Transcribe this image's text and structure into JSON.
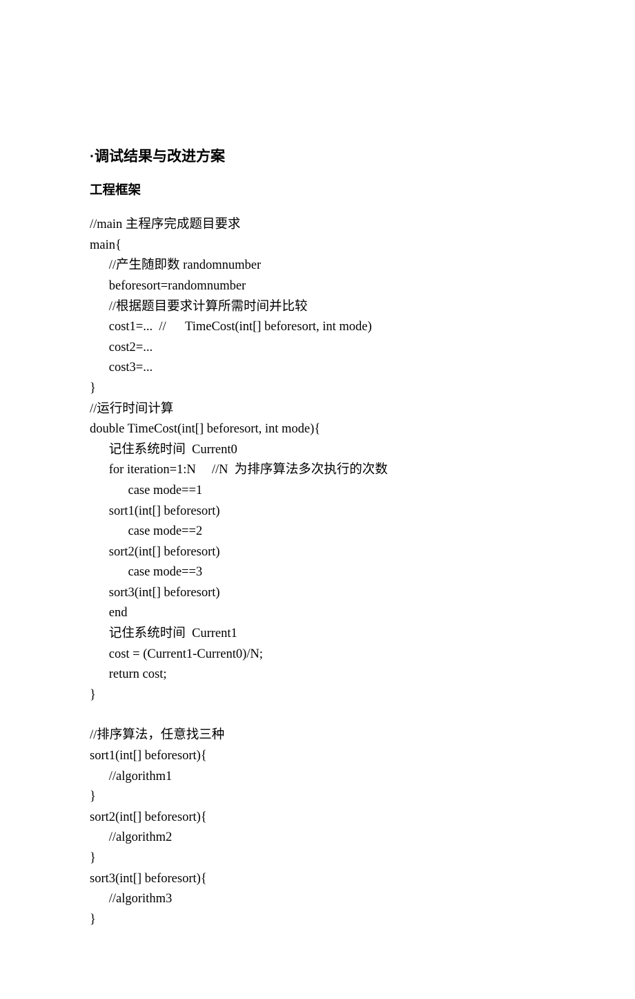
{
  "heading": "·调试结果与改进方案",
  "subheading": "工程框架",
  "lines": {
    "l1": "//main 主程序完成题目要求",
    "l2": "main{",
    "l3": "      //产生随即数 randomnumber",
    "l4": "      beforesort=randomnumber",
    "l5": "      //根据题目要求计算所需时间并比较",
    "l6": "      cost1=...  //      TimeCost(int[] beforesort, int mode)",
    "l7": "      cost2=...",
    "l8": "      cost3=...",
    "l9": "}",
    "l10": "//运行时间计算",
    "l11": "double TimeCost(int[] beforesort, int mode){",
    "l12": "      记住系统时间  Current0",
    "l13": "      for iteration=1:N     //N  为排序算法多次执行的次数",
    "l14": "            case mode==1",
    "l15": "      sort1(int[] beforesort)",
    "l16": "            case mode==2",
    "l17": "      sort2(int[] beforesort)",
    "l18": "            case mode==3",
    "l19": "      sort3(int[] beforesort)",
    "l20": "      end",
    "l21": "      记住系统时间  Current1",
    "l22": "      cost = (Current1-Current0)/N;",
    "l23": "      return cost;",
    "l24": "}",
    "l25": "//排序算法，任意找三种",
    "l26": "sort1(int[] beforesort){",
    "l27": "      //algorithm1",
    "l28": "}",
    "l29": "sort2(int[] beforesort){",
    "l30": "      //algorithm2",
    "l31": "}",
    "l32": "sort3(int[] beforesort){",
    "l33": "      //algorithm3",
    "l34": "}"
  }
}
